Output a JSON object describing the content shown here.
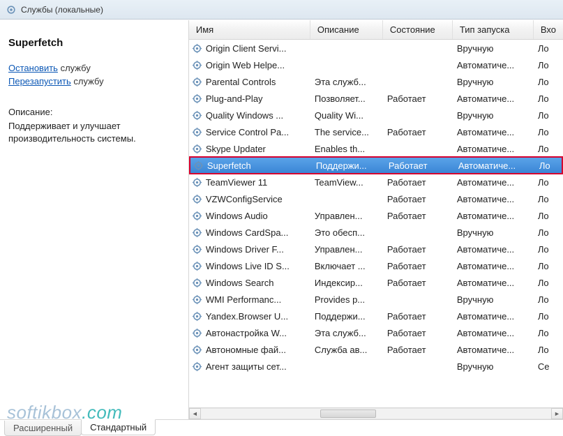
{
  "topbar": {
    "title": "Службы (локальные)"
  },
  "leftPane": {
    "serviceName": "Superfetch",
    "stop": {
      "link": "Остановить",
      "suffix": " службу"
    },
    "restart": {
      "link": "Перезапустить",
      "suffix": " службу"
    },
    "descLabel": "Описание:",
    "descText": "Поддерживает и улучшает производительность системы."
  },
  "columns": {
    "name": "Имя",
    "desc": "Описание",
    "state": "Состояние",
    "start": "Тип запуска",
    "logon": "Вхо"
  },
  "rows": [
    {
      "name": "Origin Client Servi...",
      "desc": "",
      "state": "",
      "start": "Вручную",
      "logon": "Ло"
    },
    {
      "name": "Origin Web Helpe...",
      "desc": "",
      "state": "",
      "start": "Автоматиче...",
      "logon": "Ло"
    },
    {
      "name": "Parental Controls",
      "desc": "Эта служб...",
      "state": "",
      "start": "Вручную",
      "logon": "Ло"
    },
    {
      "name": "Plug-and-Play",
      "desc": "Позволяет...",
      "state": "Работает",
      "start": "Автоматиче...",
      "logon": "Ло"
    },
    {
      "name": "Quality Windows ...",
      "desc": "Quality Wi...",
      "state": "",
      "start": "Вручную",
      "logon": "Ло"
    },
    {
      "name": "Service Control Pa...",
      "desc": "The service...",
      "state": "Работает",
      "start": "Автоматиче...",
      "logon": "Ло"
    },
    {
      "name": "Skype Updater",
      "desc": "Enables th...",
      "state": "",
      "start": "Автоматиче...",
      "logon": "Ло"
    },
    {
      "name": "Superfetch",
      "desc": "Поддержи...",
      "state": "Работает",
      "start": "Автоматиче...",
      "logon": "Ло",
      "highlighted": true
    },
    {
      "name": "TeamViewer 11",
      "desc": "TeamView...",
      "state": "Работает",
      "start": "Автоматиче...",
      "logon": "Ло"
    },
    {
      "name": "VZWConfigService",
      "desc": "",
      "state": "Работает",
      "start": "Автоматиче...",
      "logon": "Ло"
    },
    {
      "name": "Windows Audio",
      "desc": "Управлен...",
      "state": "Работает",
      "start": "Автоматиче...",
      "logon": "Ло"
    },
    {
      "name": "Windows CardSpa...",
      "desc": "Это обесп...",
      "state": "",
      "start": "Вручную",
      "logon": "Ло"
    },
    {
      "name": "Windows Driver F...",
      "desc": "Управлен...",
      "state": "Работает",
      "start": "Автоматиче...",
      "logon": "Ло"
    },
    {
      "name": "Windows Live ID S...",
      "desc": "Включает ...",
      "state": "Работает",
      "start": "Автоматиче...",
      "logon": "Ло"
    },
    {
      "name": "Windows Search",
      "desc": "Индексир...",
      "state": "Работает",
      "start": "Автоматиче...",
      "logon": "Ло"
    },
    {
      "name": "WMI Performanc...",
      "desc": "Provides p...",
      "state": "",
      "start": "Вручную",
      "logon": "Ло"
    },
    {
      "name": "Yandex.Browser U...",
      "desc": "Поддержи...",
      "state": "Работает",
      "start": "Автоматиче...",
      "logon": "Ло"
    },
    {
      "name": "Автонастройка W...",
      "desc": "Эта служб...",
      "state": "Работает",
      "start": "Автоматиче...",
      "logon": "Ло"
    },
    {
      "name": "Автономные фай...",
      "desc": "Служба ав...",
      "state": "Работает",
      "start": "Автоматиче...",
      "logon": "Ло"
    },
    {
      "name": "Агент защиты сет...",
      "desc": "",
      "state": "",
      "start": "Вручную",
      "logon": "Се"
    }
  ],
  "tabs": {
    "extended": "Расширенный",
    "standard": "Стандартный"
  },
  "watermark": {
    "left": "softikbox",
    "right": ".com"
  }
}
